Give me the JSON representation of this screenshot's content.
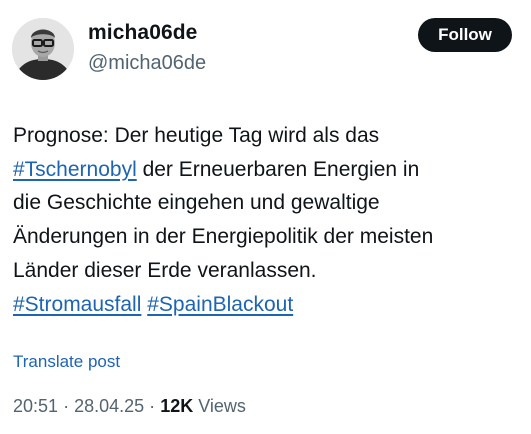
{
  "author": {
    "display_name": "micha06de",
    "handle": "@micha06de",
    "avatar": "profile-photo"
  },
  "follow_button": {
    "label": "Follow"
  },
  "post": {
    "line1": "Prognose: Der heutige Tag wird als das",
    "hashtag_1": "#Tschernobyl",
    "line2_rest": " der Erneuerbaren Energien in",
    "line3": "die Geschichte eingehen und gewaltige",
    "line4": "Änderungen in der Energiepolitik der meisten",
    "line5": "Länder dieser Erde veranlassen.",
    "hashtag_2": "#Stromausfall",
    "hashtag_3": "#SpainBlackout"
  },
  "translate_link": "Translate post",
  "meta": {
    "time": "20:51",
    "separator": "·",
    "date": "28.04.25",
    "views_count": "12K",
    "views_label": "Views"
  },
  "colors": {
    "link": "#1d64b4",
    "secondary_text": "#536471",
    "primary_text": "#0f1419",
    "button_bg": "#0f1419"
  }
}
